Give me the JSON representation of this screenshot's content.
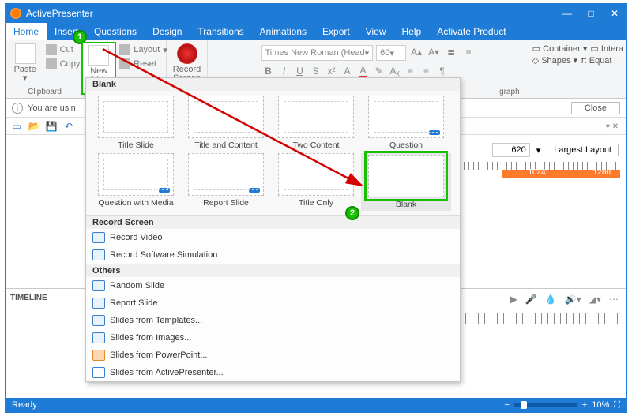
{
  "app": {
    "title": "ActivePresenter"
  },
  "window": {
    "min": "—",
    "max": "□",
    "close": "✕"
  },
  "tabs": [
    "Home",
    "Insert",
    "Questions",
    "Design",
    "Transitions",
    "Animations",
    "Export",
    "View",
    "Help",
    "Activate Product"
  ],
  "ribbon": {
    "clipboard": {
      "paste": "Paste",
      "cut": "Cut",
      "copy": "Copy",
      "label": "Clipboard"
    },
    "slide": {
      "newSlide": "New Slide",
      "layout": "Layout",
      "reset": "Reset"
    },
    "record": {
      "label": "Record Screen"
    },
    "font": {
      "name": "Times New Roman (Head",
      "size": "60"
    },
    "paragraph": "graph",
    "far": {
      "container": "Container",
      "intera": "Intera",
      "shapes": "Shapes",
      "equat": "Equat"
    }
  },
  "info": {
    "text": "You are usin",
    "close": "Close"
  },
  "panel": {
    "width": "620",
    "largest": "Largest Layout",
    "marks": {
      "a": "1024",
      "b": "1280"
    }
  },
  "dropdown": {
    "blank": "Blank",
    "thumbs": [
      {
        "label": "Title Slide"
      },
      {
        "label": "Title and Content"
      },
      {
        "label": "Two Content"
      },
      {
        "label": "Question"
      },
      {
        "label": "Question with Media"
      },
      {
        "label": "Report Slide"
      },
      {
        "label": "Title Only"
      },
      {
        "label": "Blank",
        "selected": true
      }
    ],
    "recordScreen": "Record Screen",
    "recordVideo": "Record Video",
    "recordSim": "Record Software Simulation",
    "others": "Others",
    "random": "Random Slide",
    "report": "Report Slide",
    "tmpl": "Slides from Templates...",
    "img": "Slides from Images...",
    "ppt": "Slides from PowerPoint...",
    "ap": "Slides from ActivePresenter..."
  },
  "timeline": {
    "label": "TIMELINE"
  },
  "status": {
    "ready": "Ready",
    "zoom": "10%"
  },
  "badges": {
    "one": "1",
    "two": "2"
  }
}
